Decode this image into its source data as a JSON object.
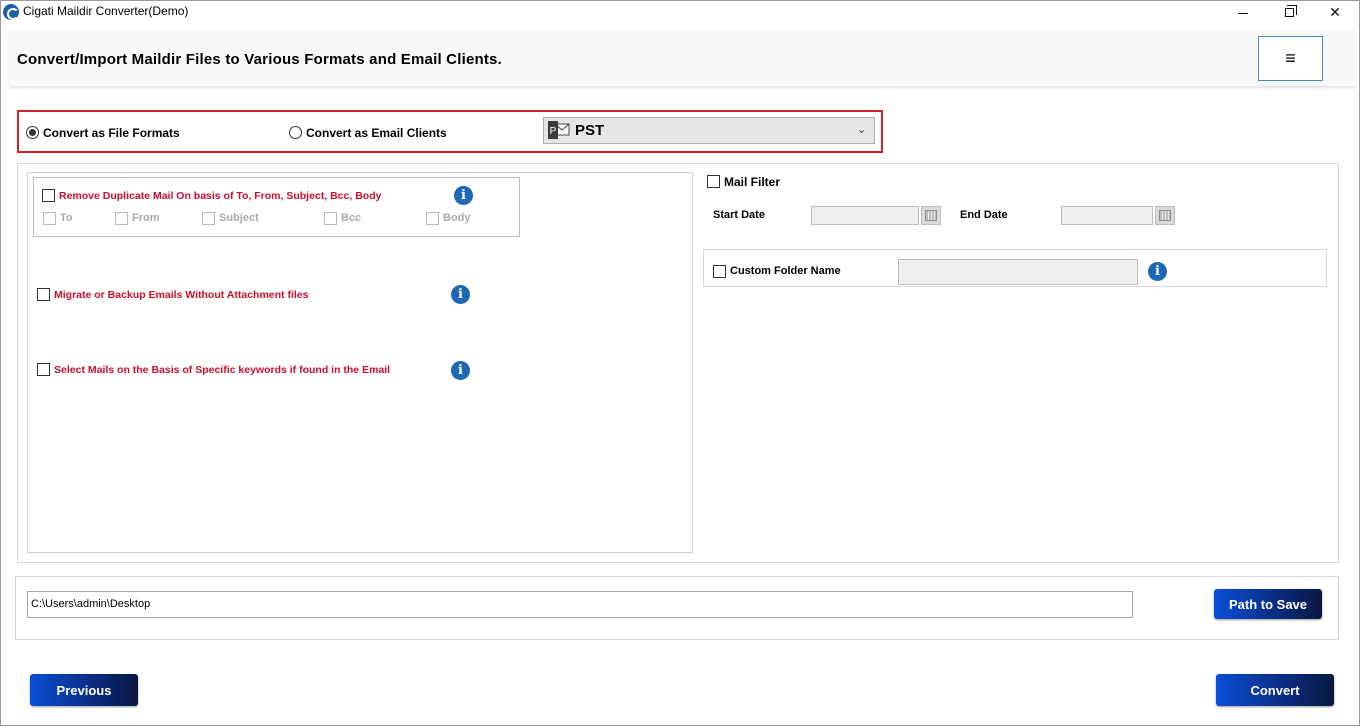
{
  "window": {
    "title": "Cigati Maildir Converter(Demo)",
    "min_glyph": "",
    "close_glyph": "✕"
  },
  "header": {
    "title": "Convert/Import Maildir Files to Various Formats and Email Clients.",
    "menu_glyph": "≡"
  },
  "conversion": {
    "options": [
      {
        "label": "Convert as File Formats",
        "selected": true
      },
      {
        "label": "Convert as Email Clients",
        "selected": false
      }
    ],
    "format_select": {
      "value": "PST",
      "icon": "outlook-pst-icon",
      "arrow": "⌄"
    }
  },
  "filters": {
    "duplicate": {
      "label": "Remove Duplicate Mail On basis of To, From, Subject, Bcc, Body",
      "fields": [
        "To",
        "From",
        "Subject",
        "Bcc",
        "Body"
      ]
    },
    "attachment": {
      "label": "Migrate or Backup Emails Without Attachment files"
    },
    "keywords": {
      "label": "Select Mails on the Basis of Specific keywords if found in the Email"
    },
    "info_glyph": "i"
  },
  "mail_filter": {
    "label": "Mail Filter",
    "start_label": "Start Date",
    "end_label": "End Date"
  },
  "custom_folder": {
    "label": "Custom Folder Name"
  },
  "path": {
    "value": "C:\\Users\\admin\\Desktop",
    "button_label": "Path to Save"
  },
  "nav": {
    "previous_label": "Previous",
    "convert_label": "Convert"
  },
  "colors": {
    "accent_red": "#c8102e",
    "button_blue": "#0a2e86",
    "info_blue": "#1c68b4"
  }
}
